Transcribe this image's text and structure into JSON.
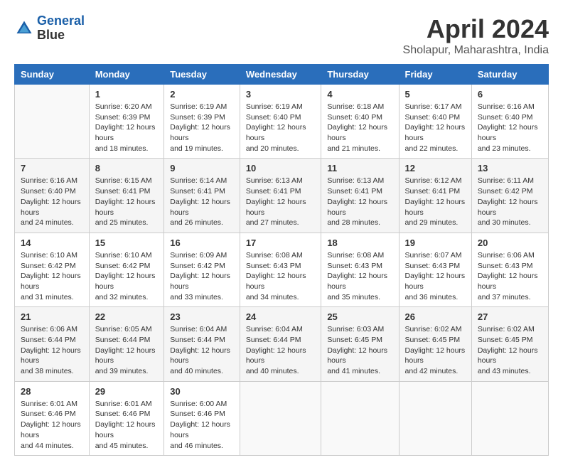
{
  "header": {
    "logo_line1": "General",
    "logo_line2": "Blue",
    "main_title": "April 2024",
    "subtitle": "Sholapur, Maharashtra, India"
  },
  "calendar": {
    "days_of_week": [
      "Sunday",
      "Monday",
      "Tuesday",
      "Wednesday",
      "Thursday",
      "Friday",
      "Saturday"
    ],
    "weeks": [
      [
        {
          "day": "",
          "sunrise": "",
          "sunset": "",
          "daylight": "",
          "empty": true
        },
        {
          "day": "1",
          "sunrise": "Sunrise: 6:20 AM",
          "sunset": "Sunset: 6:39 PM",
          "daylight": "Daylight: 12 hours and 18 minutes."
        },
        {
          "day": "2",
          "sunrise": "Sunrise: 6:19 AM",
          "sunset": "Sunset: 6:39 PM",
          "daylight": "Daylight: 12 hours and 19 minutes."
        },
        {
          "day": "3",
          "sunrise": "Sunrise: 6:19 AM",
          "sunset": "Sunset: 6:40 PM",
          "daylight": "Daylight: 12 hours and 20 minutes."
        },
        {
          "day": "4",
          "sunrise": "Sunrise: 6:18 AM",
          "sunset": "Sunset: 6:40 PM",
          "daylight": "Daylight: 12 hours and 21 minutes."
        },
        {
          "day": "5",
          "sunrise": "Sunrise: 6:17 AM",
          "sunset": "Sunset: 6:40 PM",
          "daylight": "Daylight: 12 hours and 22 minutes."
        },
        {
          "day": "6",
          "sunrise": "Sunrise: 6:16 AM",
          "sunset": "Sunset: 6:40 PM",
          "daylight": "Daylight: 12 hours and 23 minutes."
        }
      ],
      [
        {
          "day": "7",
          "sunrise": "Sunrise: 6:16 AM",
          "sunset": "Sunset: 6:40 PM",
          "daylight": "Daylight: 12 hours and 24 minutes."
        },
        {
          "day": "8",
          "sunrise": "Sunrise: 6:15 AM",
          "sunset": "Sunset: 6:41 PM",
          "daylight": "Daylight: 12 hours and 25 minutes."
        },
        {
          "day": "9",
          "sunrise": "Sunrise: 6:14 AM",
          "sunset": "Sunset: 6:41 PM",
          "daylight": "Daylight: 12 hours and 26 minutes."
        },
        {
          "day": "10",
          "sunrise": "Sunrise: 6:13 AM",
          "sunset": "Sunset: 6:41 PM",
          "daylight": "Daylight: 12 hours and 27 minutes."
        },
        {
          "day": "11",
          "sunrise": "Sunrise: 6:13 AM",
          "sunset": "Sunset: 6:41 PM",
          "daylight": "Daylight: 12 hours and 28 minutes."
        },
        {
          "day": "12",
          "sunrise": "Sunrise: 6:12 AM",
          "sunset": "Sunset: 6:41 PM",
          "daylight": "Daylight: 12 hours and 29 minutes."
        },
        {
          "day": "13",
          "sunrise": "Sunrise: 6:11 AM",
          "sunset": "Sunset: 6:42 PM",
          "daylight": "Daylight: 12 hours and 30 minutes."
        }
      ],
      [
        {
          "day": "14",
          "sunrise": "Sunrise: 6:10 AM",
          "sunset": "Sunset: 6:42 PM",
          "daylight": "Daylight: 12 hours and 31 minutes."
        },
        {
          "day": "15",
          "sunrise": "Sunrise: 6:10 AM",
          "sunset": "Sunset: 6:42 PM",
          "daylight": "Daylight: 12 hours and 32 minutes."
        },
        {
          "day": "16",
          "sunrise": "Sunrise: 6:09 AM",
          "sunset": "Sunset: 6:42 PM",
          "daylight": "Daylight: 12 hours and 33 minutes."
        },
        {
          "day": "17",
          "sunrise": "Sunrise: 6:08 AM",
          "sunset": "Sunset: 6:43 PM",
          "daylight": "Daylight: 12 hours and 34 minutes."
        },
        {
          "day": "18",
          "sunrise": "Sunrise: 6:08 AM",
          "sunset": "Sunset: 6:43 PM",
          "daylight": "Daylight: 12 hours and 35 minutes."
        },
        {
          "day": "19",
          "sunrise": "Sunrise: 6:07 AM",
          "sunset": "Sunset: 6:43 PM",
          "daylight": "Daylight: 12 hours and 36 minutes."
        },
        {
          "day": "20",
          "sunrise": "Sunrise: 6:06 AM",
          "sunset": "Sunset: 6:43 PM",
          "daylight": "Daylight: 12 hours and 37 minutes."
        }
      ],
      [
        {
          "day": "21",
          "sunrise": "Sunrise: 6:06 AM",
          "sunset": "Sunset: 6:44 PM",
          "daylight": "Daylight: 12 hours and 38 minutes."
        },
        {
          "day": "22",
          "sunrise": "Sunrise: 6:05 AM",
          "sunset": "Sunset: 6:44 PM",
          "daylight": "Daylight: 12 hours and 39 minutes."
        },
        {
          "day": "23",
          "sunrise": "Sunrise: 6:04 AM",
          "sunset": "Sunset: 6:44 PM",
          "daylight": "Daylight: 12 hours and 40 minutes."
        },
        {
          "day": "24",
          "sunrise": "Sunrise: 6:04 AM",
          "sunset": "Sunset: 6:44 PM",
          "daylight": "Daylight: 12 hours and 40 minutes."
        },
        {
          "day": "25",
          "sunrise": "Sunrise: 6:03 AM",
          "sunset": "Sunset: 6:45 PM",
          "daylight": "Daylight: 12 hours and 41 minutes."
        },
        {
          "day": "26",
          "sunrise": "Sunrise: 6:02 AM",
          "sunset": "Sunset: 6:45 PM",
          "daylight": "Daylight: 12 hours and 42 minutes."
        },
        {
          "day": "27",
          "sunrise": "Sunrise: 6:02 AM",
          "sunset": "Sunset: 6:45 PM",
          "daylight": "Daylight: 12 hours and 43 minutes."
        }
      ],
      [
        {
          "day": "28",
          "sunrise": "Sunrise: 6:01 AM",
          "sunset": "Sunset: 6:46 PM",
          "daylight": "Daylight: 12 hours and 44 minutes."
        },
        {
          "day": "29",
          "sunrise": "Sunrise: 6:01 AM",
          "sunset": "Sunset: 6:46 PM",
          "daylight": "Daylight: 12 hours and 45 minutes."
        },
        {
          "day": "30",
          "sunrise": "Sunrise: 6:00 AM",
          "sunset": "Sunset: 6:46 PM",
          "daylight": "Daylight: 12 hours and 46 minutes."
        },
        {
          "day": "",
          "sunrise": "",
          "sunset": "",
          "daylight": "",
          "empty": true
        },
        {
          "day": "",
          "sunrise": "",
          "sunset": "",
          "daylight": "",
          "empty": true
        },
        {
          "day": "",
          "sunrise": "",
          "sunset": "",
          "daylight": "",
          "empty": true
        },
        {
          "day": "",
          "sunrise": "",
          "sunset": "",
          "daylight": "",
          "empty": true
        }
      ]
    ]
  }
}
